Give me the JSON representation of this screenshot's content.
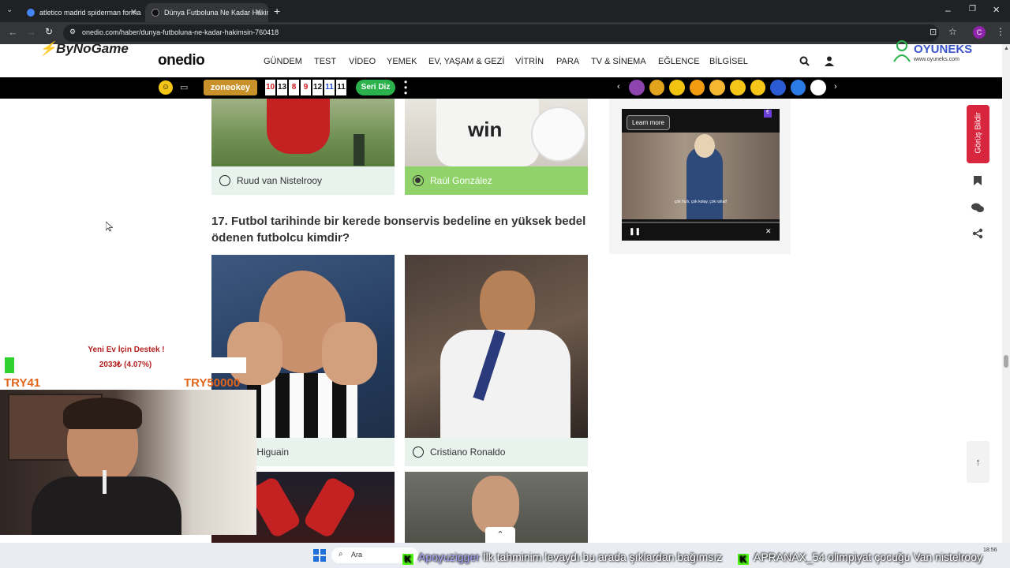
{
  "browser": {
    "tabs": [
      {
        "title": "atletico madrid spiderman forma"
      },
      {
        "title": "Dünya Futboluna Ne Kadar Hakimsin"
      }
    ],
    "url": "onedio.com/haber/dunya-futboluna-ne-kadar-hakimsin-760418",
    "profile_initial": "C"
  },
  "overlay": {
    "left_brand": "ByNoGame",
    "right_brand": "OYUNEKS",
    "right_brand_url": "www.oyuneks.com",
    "donation_title": "Yeni Ev İçin Destek !",
    "donation_progress_text": "2033₺ (4.07%)",
    "donation_progress_fraction": 0.0407,
    "donation_min": "TRY41",
    "donation_max": "TRY50000"
  },
  "site": {
    "logo": "onedio",
    "nav": [
      "GÜNDEM",
      "TEST",
      "VİDEO",
      "YEMEK",
      "EV, YAŞAM & GEZİ",
      "VİTRİN",
      "PARA",
      "TV & SİNEMA",
      "EĞLENCE",
      "BİLGİSEL"
    ],
    "zonebar": {
      "brand": "zoneokey",
      "tiles": [
        "10",
        "13",
        "8",
        "9",
        "12",
        "11",
        "11"
      ],
      "button": "Seri Diz"
    },
    "feedback_button": "Görüş Bildir"
  },
  "quiz": {
    "prev_options": [
      {
        "label": "Ruud van Nistelrooy",
        "selected": false
      },
      {
        "label": "Raúl González",
        "selected": true
      }
    ],
    "question": "17. Futbol tarihinde bir kerede bonservis bedeline en yüksek bedel ödenen futbolcu kimdir?",
    "options": [
      {
        "label": "zalo Higuain",
        "selected": false
      },
      {
        "label": "Cristiano Ronaldo",
        "selected": false
      }
    ]
  },
  "ad": {
    "learn_more": "Learn more",
    "subtitle": "çok hızlı, çok kolay, çok rahat!"
  },
  "taskbar": {
    "search_placeholder": "Ara",
    "time": "18:56"
  },
  "ticker": {
    "items": [
      {
        "user": "Apoyuzigger",
        "message": "İlk tahminim levaydı bu arada şıklardan bağımsız"
      },
      {
        "user": "APRANAX_54",
        "message": "olimpiyat çocuğu Van nistelrooy"
      }
    ]
  },
  "colors": {
    "selected_option_bg": "#8fd36a",
    "option_bg": "#e8f3ee",
    "feedback_red": "#d7263d",
    "kick_green": "#53fc18"
  }
}
